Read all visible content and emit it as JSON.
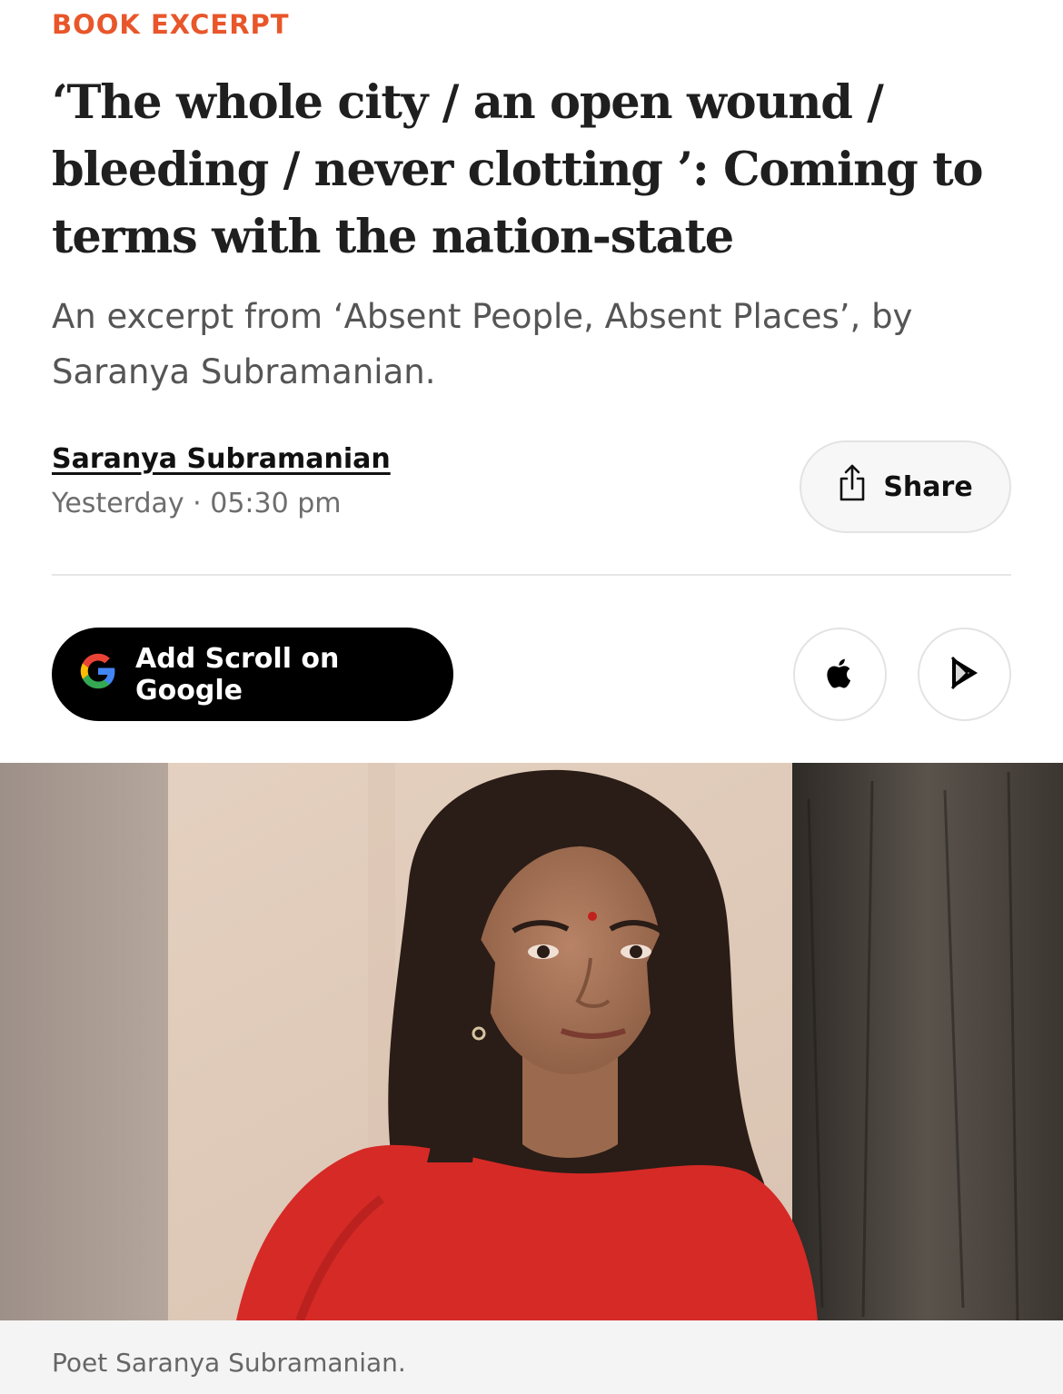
{
  "article": {
    "kicker": "BOOK EXCERPT",
    "headline": "‘The whole city / an open wound / bleeding / never clotting ’: Coming to terms with the nation-state",
    "dek": "An excerpt from ‘Absent People, Absent Places’, by Saranya Subramanian.",
    "author": "Saranya Subramanian",
    "dateline": "Yesterday · 05:30 pm"
  },
  "actions": {
    "share_label": "Share",
    "share_icon": "share-icon",
    "google_label": "Add Scroll on Google",
    "google_icon": "google-g-icon",
    "apple_icon": "apple-icon",
    "play_icon": "google-play-icon"
  },
  "image": {
    "caption": "Poet Saranya Subramanian."
  },
  "colors": {
    "kicker": "#e8562a",
    "google_button": "#000000"
  }
}
